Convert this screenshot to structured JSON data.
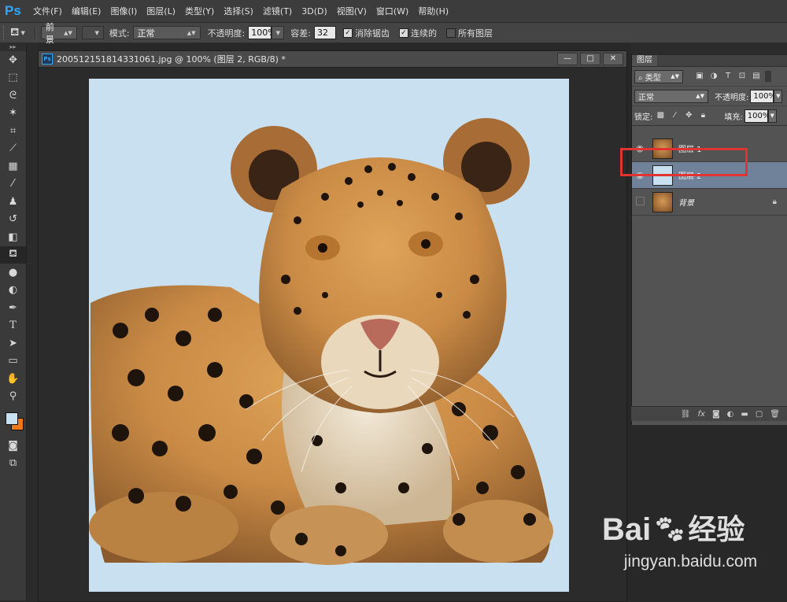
{
  "app": {
    "logo": "Ps"
  },
  "menu": [
    "文件(F)",
    "编辑(E)",
    "图像(I)",
    "图层(L)",
    "类型(Y)",
    "选择(S)",
    "滤镜(T)",
    "3D(D)",
    "视图(V)",
    "窗口(W)",
    "帮助(H)"
  ],
  "options": {
    "fill_source": "前景",
    "mode_label": "模式:",
    "mode_value": "正常",
    "opacity_label": "不透明度:",
    "opacity_value": "100%",
    "tolerance_label": "容差:",
    "tolerance_value": "32",
    "antialias_label": "消除锯齿",
    "contiguous_label": "连续的",
    "all_layers_label": "所有图层"
  },
  "document": {
    "title": "200512151814331061.jpg @ 100% (图层 2, RGB/8) *",
    "canvas_color": "#c8e0ef"
  },
  "layers_panel": {
    "tab": "图层",
    "kind_filter": "类型",
    "blend_mode": "正常",
    "opacity_label": "不透明度:",
    "opacity_value": "100%",
    "lock_label": "锁定:",
    "fill_label": "填充:",
    "fill_value": "100%",
    "layers": [
      {
        "name": "图层 1",
        "visible": true,
        "selected": false
      },
      {
        "name": "图层 2",
        "visible": true,
        "selected": true
      },
      {
        "name": "背景",
        "visible": false,
        "selected": false,
        "locked": true
      }
    ]
  },
  "colors": {
    "foreground": "#c8e0ef",
    "background": "#f07818",
    "highlight": "#e23333"
  },
  "watermark": {
    "brand_a": "Bai",
    "brand_b": "经验",
    "url": "jingyan.baidu.com"
  }
}
